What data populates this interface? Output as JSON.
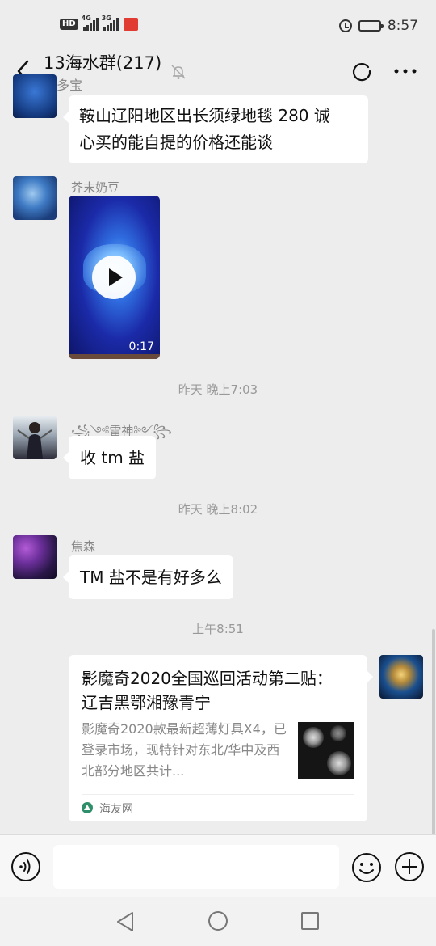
{
  "status_bar": {
    "network_badge": "HD",
    "signal1_label": "4G",
    "signal2_label": "3G",
    "time": "8:57",
    "battery_level": 0.85
  },
  "header": {
    "title": "13海水群(217)",
    "subtitle": "海多宝"
  },
  "messages": [
    {
      "type": "text",
      "text_line1": "鞍山辽阳地区出长须绿地毯 280  诚",
      "text_line2": "心买的能自提的价格还能谈"
    },
    {
      "type": "video",
      "sender": "芥末奶豆",
      "duration": "0:17"
    },
    {
      "type": "timestamp",
      "text": "昨天 晚上7:03"
    },
    {
      "type": "text",
      "sender": "꧁༺雷神༻꧂",
      "text": "收 tm 盐"
    },
    {
      "type": "timestamp",
      "text": "昨天 晚上8:02"
    },
    {
      "type": "text",
      "sender": "焦森",
      "text": "TM 盐不是有好多么"
    },
    {
      "type": "timestamp",
      "text": "上午8:51"
    },
    {
      "type": "link_card",
      "title": "影魔奇2020全国巡回活动第二贴： 辽吉黑鄂湘豫青宁",
      "description": "影魔奇2020款最新超薄灯具X4，已登录市场，现特针对东北/华中及西北部分地区共计...",
      "source": "海友网"
    }
  ],
  "colors": {
    "background": "#ededed",
    "bubble": "#ffffff",
    "timestamp_text": "#999999",
    "sender_text": "#888888"
  }
}
